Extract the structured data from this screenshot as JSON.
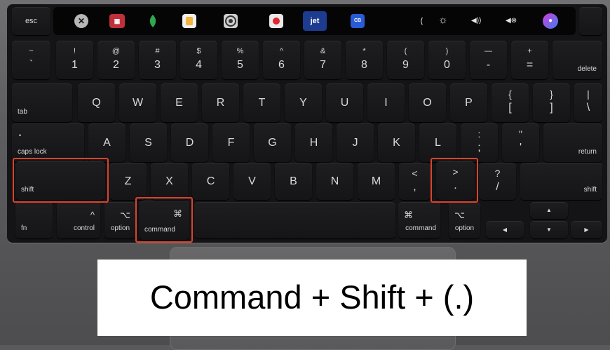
{
  "caption": "Command + Shift + (.)",
  "colors": {
    "highlight": "#d9432c"
  },
  "touch_bar": {
    "icons": [
      "close-icon",
      "app-icon-red",
      "app-icon-green-leaf",
      "app-icon-yellow",
      "app-icon-target",
      "app-icon-red-dot",
      "jet-icon",
      "app-icon-blue",
      "chevron-left-icon",
      "brightness-icon",
      "volume-up-icon",
      "mute-icon",
      "siri-icon"
    ],
    "jet_label": "jet",
    "blue_label": "CB",
    "left": "⟨",
    "brightness": "☼",
    "volume": "◀))",
    "mute": "◀⊗",
    "siri": "◉"
  },
  "keys": {
    "esc": "esc",
    "tilde": {
      "top": "~",
      "bottom": "`"
    },
    "n1": {
      "top": "!",
      "bottom": "1"
    },
    "n2": {
      "top": "@",
      "bottom": "2"
    },
    "n3": {
      "top": "#",
      "bottom": "3"
    },
    "n4": {
      "top": "$",
      "bottom": "4"
    },
    "n5": {
      "top": "%",
      "bottom": "5"
    },
    "n6": {
      "top": "^",
      "bottom": "6"
    },
    "n7": {
      "top": "&",
      "bottom": "7"
    },
    "n8": {
      "top": "*",
      "bottom": "8"
    },
    "n9": {
      "top": "(",
      "bottom": "9"
    },
    "n0": {
      "top": ")",
      "bottom": "0"
    },
    "minus": {
      "top": "—",
      "bottom": "-"
    },
    "equals": {
      "top": "+",
      "bottom": "="
    },
    "delete": "delete",
    "tab": "tab",
    "row_qwerty": [
      "Q",
      "W",
      "E",
      "R",
      "T",
      "Y",
      "U",
      "I",
      "O",
      "P"
    ],
    "lbracket": {
      "top": "{",
      "bottom": "["
    },
    "rbracket": {
      "top": "}",
      "bottom": "]"
    },
    "pipe": {
      "top": "|",
      "bottom": "\\"
    },
    "capslock": "caps lock",
    "caps_dot": "•",
    "row_asdf": [
      "A",
      "S",
      "D",
      "F",
      "G",
      "H",
      "J",
      "K",
      "L"
    ],
    "semicolon": {
      "top": ":",
      "bottom": ";"
    },
    "quote": {
      "top": "\"",
      "bottom": "'"
    },
    "return": "return",
    "shift_left": "shift",
    "row_zxcv": [
      "Z",
      "X",
      "C",
      "V",
      "B",
      "N",
      "M"
    ],
    "comma": {
      "top": "<",
      "bottom": ","
    },
    "period": {
      "top": ">",
      "bottom": "."
    },
    "slash": {
      "top": "?",
      "bottom": "/"
    },
    "shift_right": "shift",
    "fn": "fn",
    "control": {
      "symbol": "^",
      "label": "control"
    },
    "option_left": {
      "symbol": "⌥",
      "label": "option"
    },
    "command_left": {
      "symbol": "⌘",
      "label": "command"
    },
    "command_right": {
      "symbol": "⌘",
      "label": "command"
    },
    "option_right": {
      "symbol": "⌥",
      "label": "option"
    },
    "arrows": {
      "left": "◀",
      "up": "▲",
      "down": "▼",
      "right": "▶"
    }
  }
}
